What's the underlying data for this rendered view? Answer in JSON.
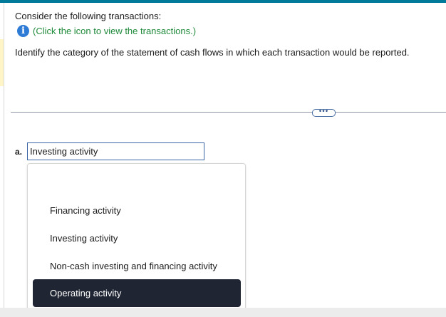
{
  "question": {
    "intro": "Consider the following transactions:",
    "info_link": "(Click the icon to view the transactions.)",
    "info_icon_glyph": "i",
    "instruction": "Identify the category of the statement of cash flows in which each transaction would be reported.",
    "expand_glyph": "•••"
  },
  "item": {
    "letter": "a.",
    "selected_value": "Investing activity"
  },
  "dropdown": {
    "options": [
      "Financing activity",
      "Investing activity",
      "Non-cash investing and financing activity",
      "Operating activity"
    ],
    "highlighted": "Operating activity"
  },
  "colors": {
    "top_bar": "#007a99",
    "info_icon": "#2e7bd6",
    "info_link": "#1f8a3b",
    "highlight_bg": "#1f2533"
  }
}
